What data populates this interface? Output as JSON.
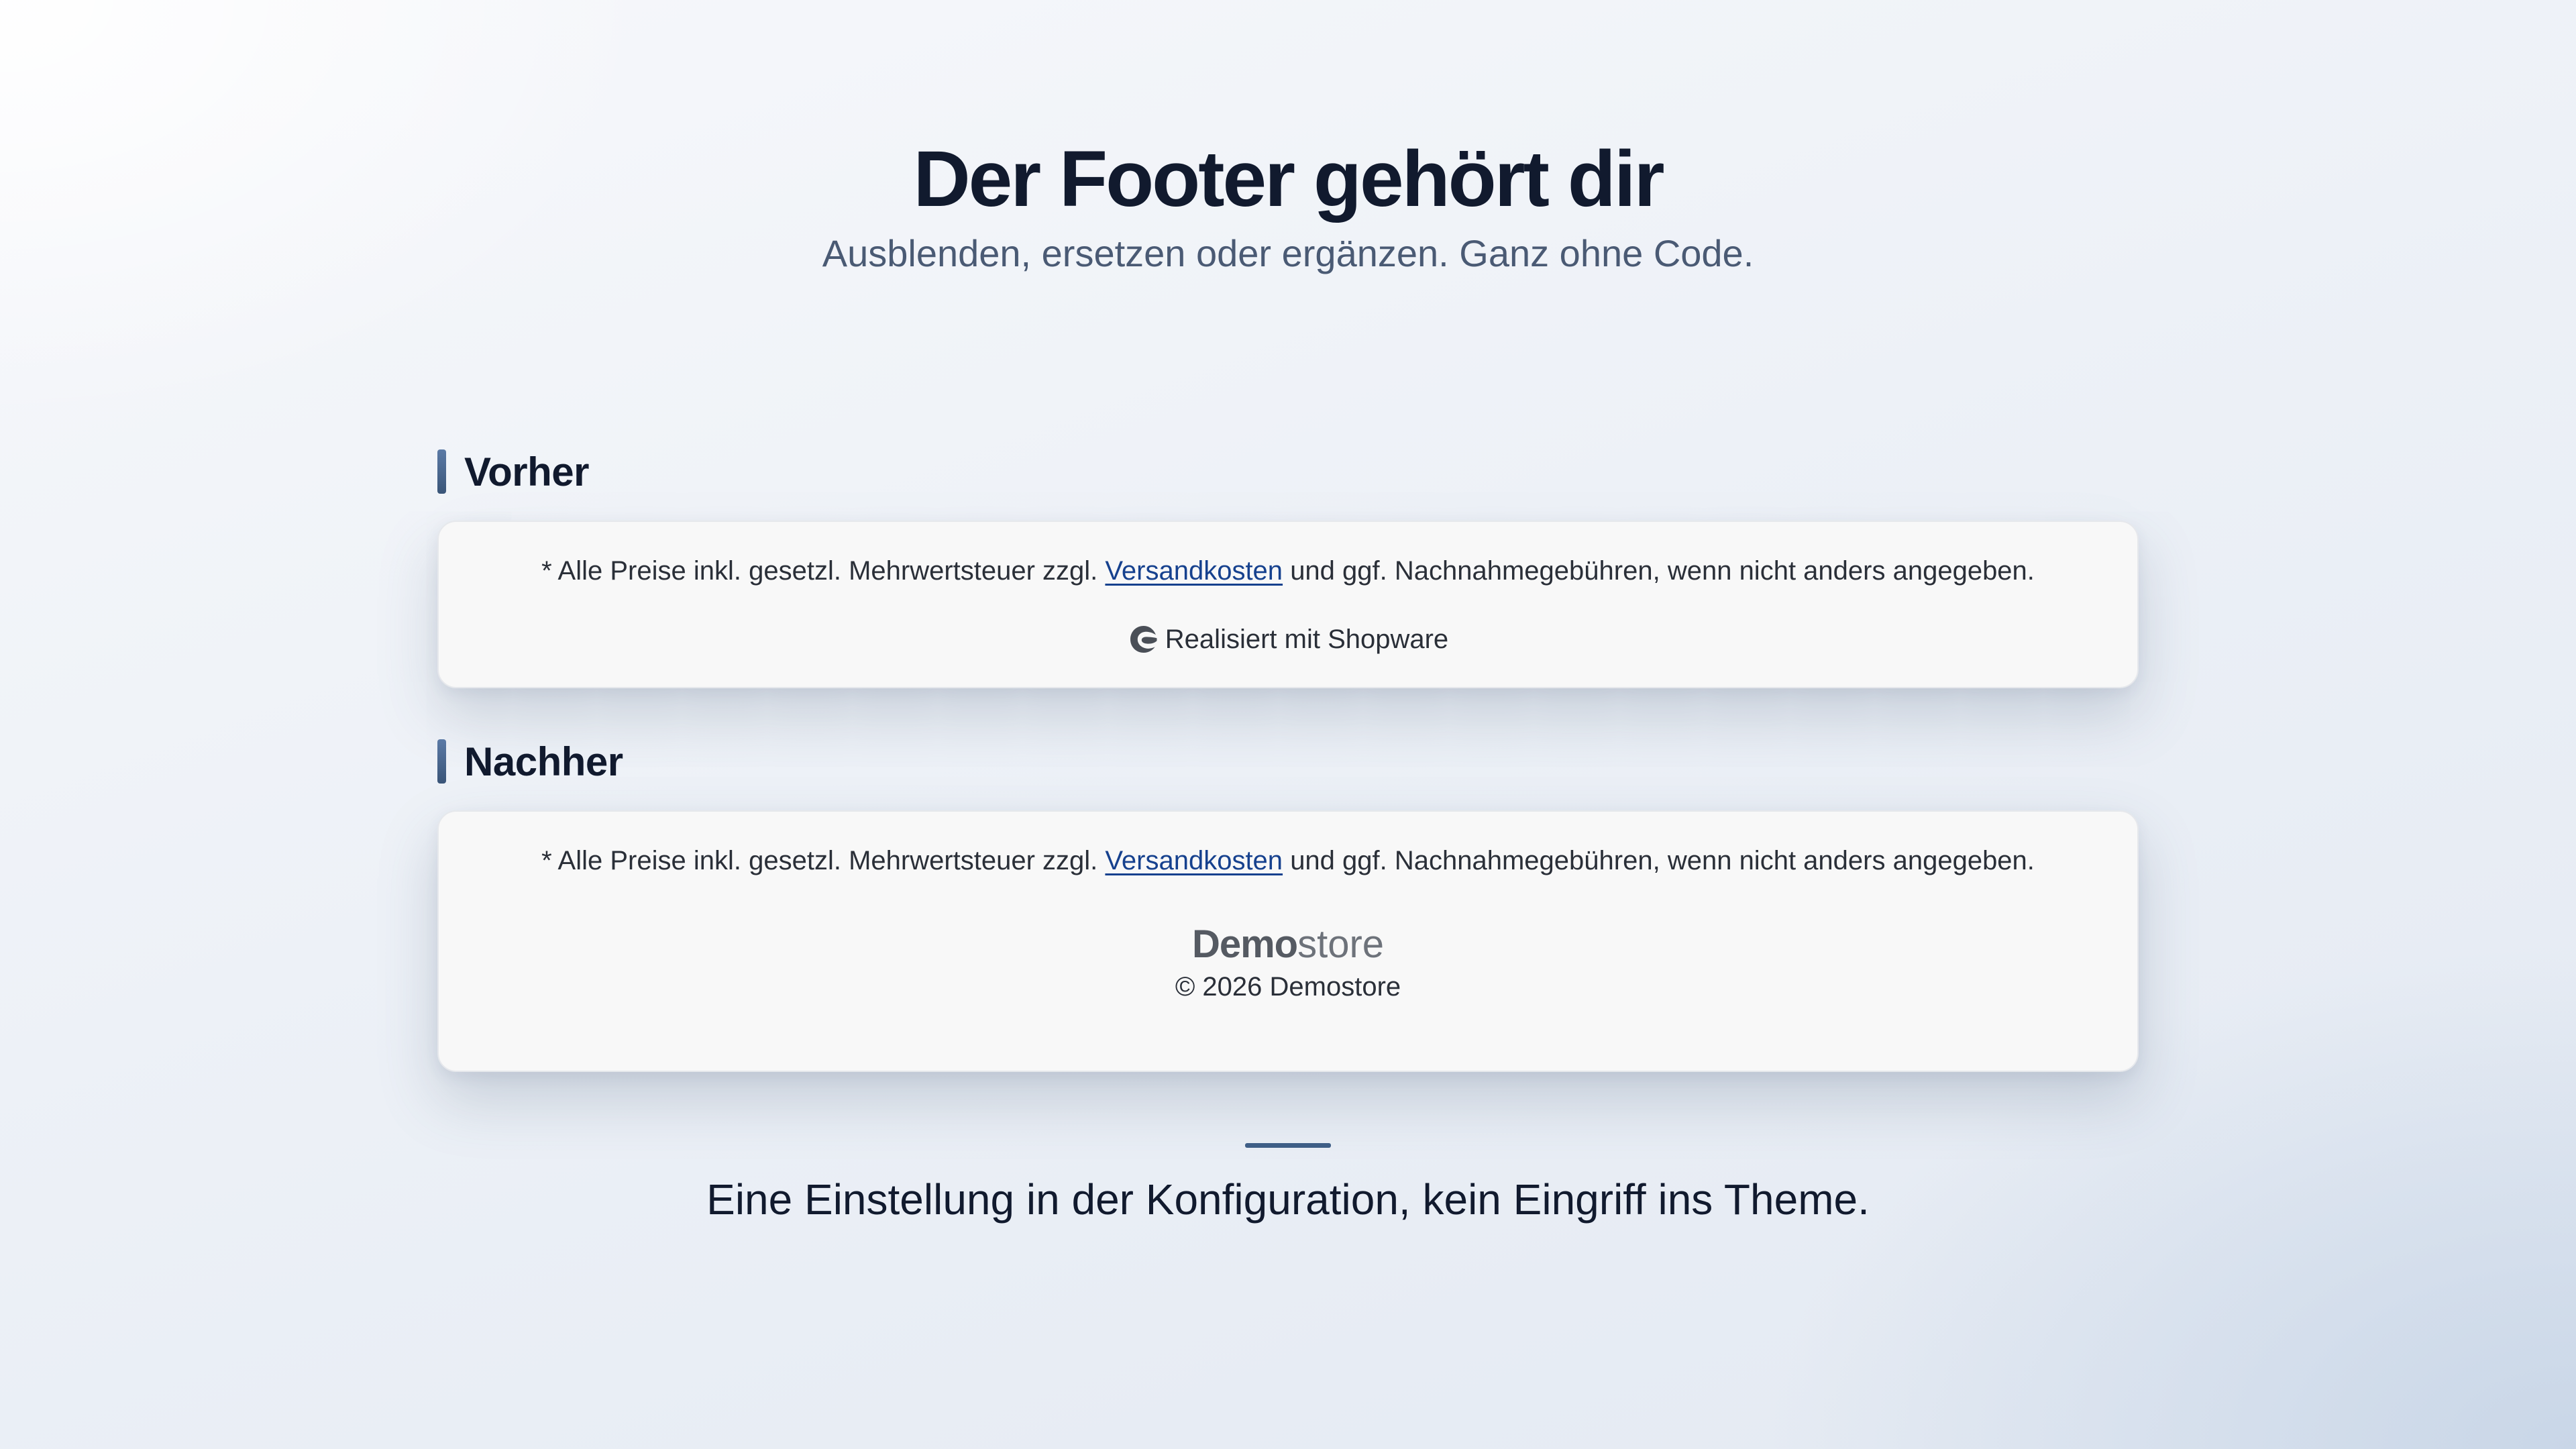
{
  "hero": {
    "title": "Der Footer gehört dir",
    "subtitle": "Ausblenden, ersetzen oder ergänzen. Ganz ohne Code."
  },
  "before": {
    "heading": "Vorher",
    "vat_prefix": "* Alle Preise inkl. gesetzl. Mehrwertsteuer zzgl.",
    "shipping_link": "Versandkosten",
    "vat_suffix": "und ggf. Nachnahmegebühren, wenn nicht anders angegeben.",
    "powered_by": "Realisiert mit Shopware",
    "powered_icon": "shopware-logo-icon"
  },
  "after": {
    "heading": "Nachher",
    "vat_prefix": "* Alle Preise inkl. gesetzl. Mehrwertsteuer zzgl.",
    "shipping_link": "Versandkosten",
    "vat_suffix": "und ggf. Nachnahmegebühren, wenn nicht anders angegeben.",
    "brand_bold": "Demo",
    "brand_light": "store",
    "copyright": "© 2026 Demostore"
  },
  "closing": "Eine Einstellung in der Konfiguration, kein Eingriff ins Theme.",
  "colors": {
    "accent": "#3e5e86",
    "link": "#16418e",
    "heading": "#111a2e",
    "card_bg": "#f8f8f8"
  }
}
